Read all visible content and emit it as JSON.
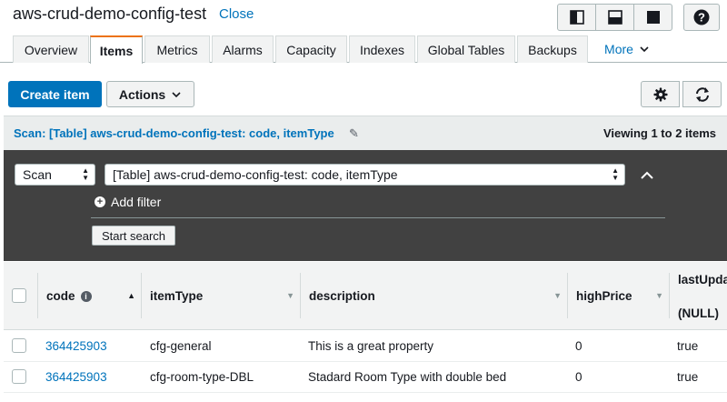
{
  "header": {
    "title": "aws-crud-demo-config-test",
    "close_label": "Close",
    "help_label": "?"
  },
  "tabs": [
    {
      "label": "Overview"
    },
    {
      "label": "Items"
    },
    {
      "label": "Metrics"
    },
    {
      "label": "Alarms"
    },
    {
      "label": "Capacity"
    },
    {
      "label": "Indexes"
    },
    {
      "label": "Global Tables"
    },
    {
      "label": "Backups"
    },
    {
      "label": "More"
    }
  ],
  "toolbar": {
    "create_label": "Create item",
    "actions_label": "Actions"
  },
  "scan_bar": {
    "title": "Scan: [Table] aws-crud-demo-config-test: code, itemType",
    "viewing": "Viewing 1 to 2 items"
  },
  "scan_panel": {
    "mode": "Scan",
    "target": "[Table] aws-crud-demo-config-test: code, itemType",
    "add_filter_label": "Add filter",
    "start_label": "Start search"
  },
  "table": {
    "columns": [
      "code",
      "itemType",
      "description",
      "highPrice",
      "lastUpda",
      "(NULL)"
    ],
    "rows": [
      {
        "code": "364425903",
        "itemType": "cfg-general",
        "description": "This is a great property",
        "highPrice": "0",
        "last": "true"
      },
      {
        "code": "364425903",
        "itemType": "cfg-room-type-DBL",
        "description": "Stadard Room Type with double bed",
        "highPrice": "0",
        "last": "true"
      }
    ]
  },
  "colors": {
    "accent": "#0073bb",
    "active_tab": "#ec7211",
    "panel_dark": "#414141"
  }
}
